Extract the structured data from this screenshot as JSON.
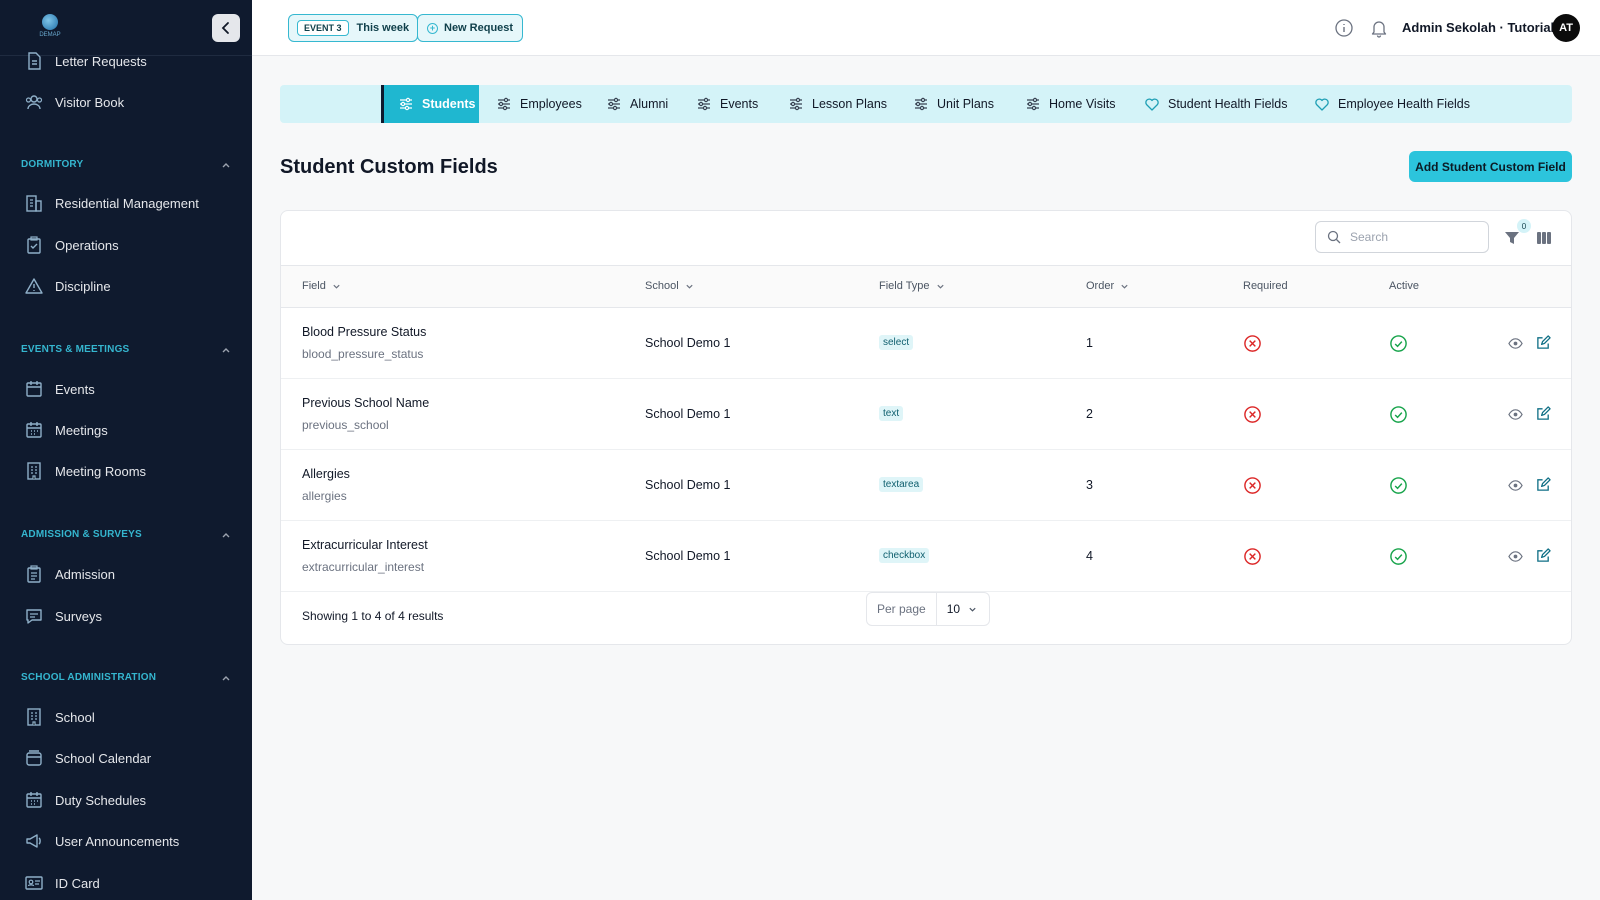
{
  "sidebar": {
    "logo_text": "DEMAP",
    "top_items": [
      "Letter Requests",
      "Visitor Book"
    ],
    "sections": [
      {
        "title": "DORMITORY",
        "items": [
          "Residential Management",
          "Operations",
          "Discipline"
        ]
      },
      {
        "title": "EVENTS & MEETINGS",
        "items": [
          "Events",
          "Meetings",
          "Meeting Rooms"
        ]
      },
      {
        "title": "ADMISSION & SURVEYS",
        "items": [
          "Admission",
          "Surveys"
        ]
      },
      {
        "title": "SCHOOL ADMINISTRATION",
        "items": [
          "School",
          "School Calendar",
          "Duty Schedules",
          "User Announcements",
          "ID Card"
        ]
      }
    ]
  },
  "header": {
    "event_badge": "EVENT 3",
    "event_label": "This week",
    "new_request": "New Request",
    "user_name": "Admin Sekolah · Tutorial",
    "avatar_initials": "AT"
  },
  "tabs": [
    "Students",
    "Employees",
    "Alumni",
    "Events",
    "Lesson Plans",
    "Unit Plans",
    "Home Visits",
    "Student Health Fields",
    "Employee Health Fields"
  ],
  "page": {
    "title": "Student Custom Fields",
    "add_button": "Add Student Custom Field"
  },
  "table": {
    "search_placeholder": "Search",
    "filter_count": "0",
    "columns": [
      "Field",
      "School",
      "Field Type",
      "Order",
      "Required",
      "Active"
    ],
    "rows": [
      {
        "name": "Blood Pressure Status",
        "key": "blood_pressure_status",
        "school": "School Demo 1",
        "type": "select",
        "order": "1",
        "required": false,
        "active": true
      },
      {
        "name": "Previous School Name",
        "key": "previous_school",
        "school": "School Demo 1",
        "type": "text",
        "order": "2",
        "required": false,
        "active": true
      },
      {
        "name": "Allergies",
        "key": "allergies",
        "school": "School Demo 1",
        "type": "textarea",
        "order": "3",
        "required": false,
        "active": true
      },
      {
        "name": "Extracurricular Interest",
        "key": "extracurricular_interest",
        "school": "School Demo 1",
        "type": "checkbox",
        "order": "4",
        "required": false,
        "active": true
      }
    ],
    "summary": "Showing 1 to 4 of 4 results",
    "per_page_label": "Per page",
    "per_page_value": "10"
  },
  "colors": {
    "sidebar_bg": "#0f1a2e",
    "accent": "#1fb7d0",
    "required_no": "#dc2626",
    "active_yes": "#16a34a"
  }
}
